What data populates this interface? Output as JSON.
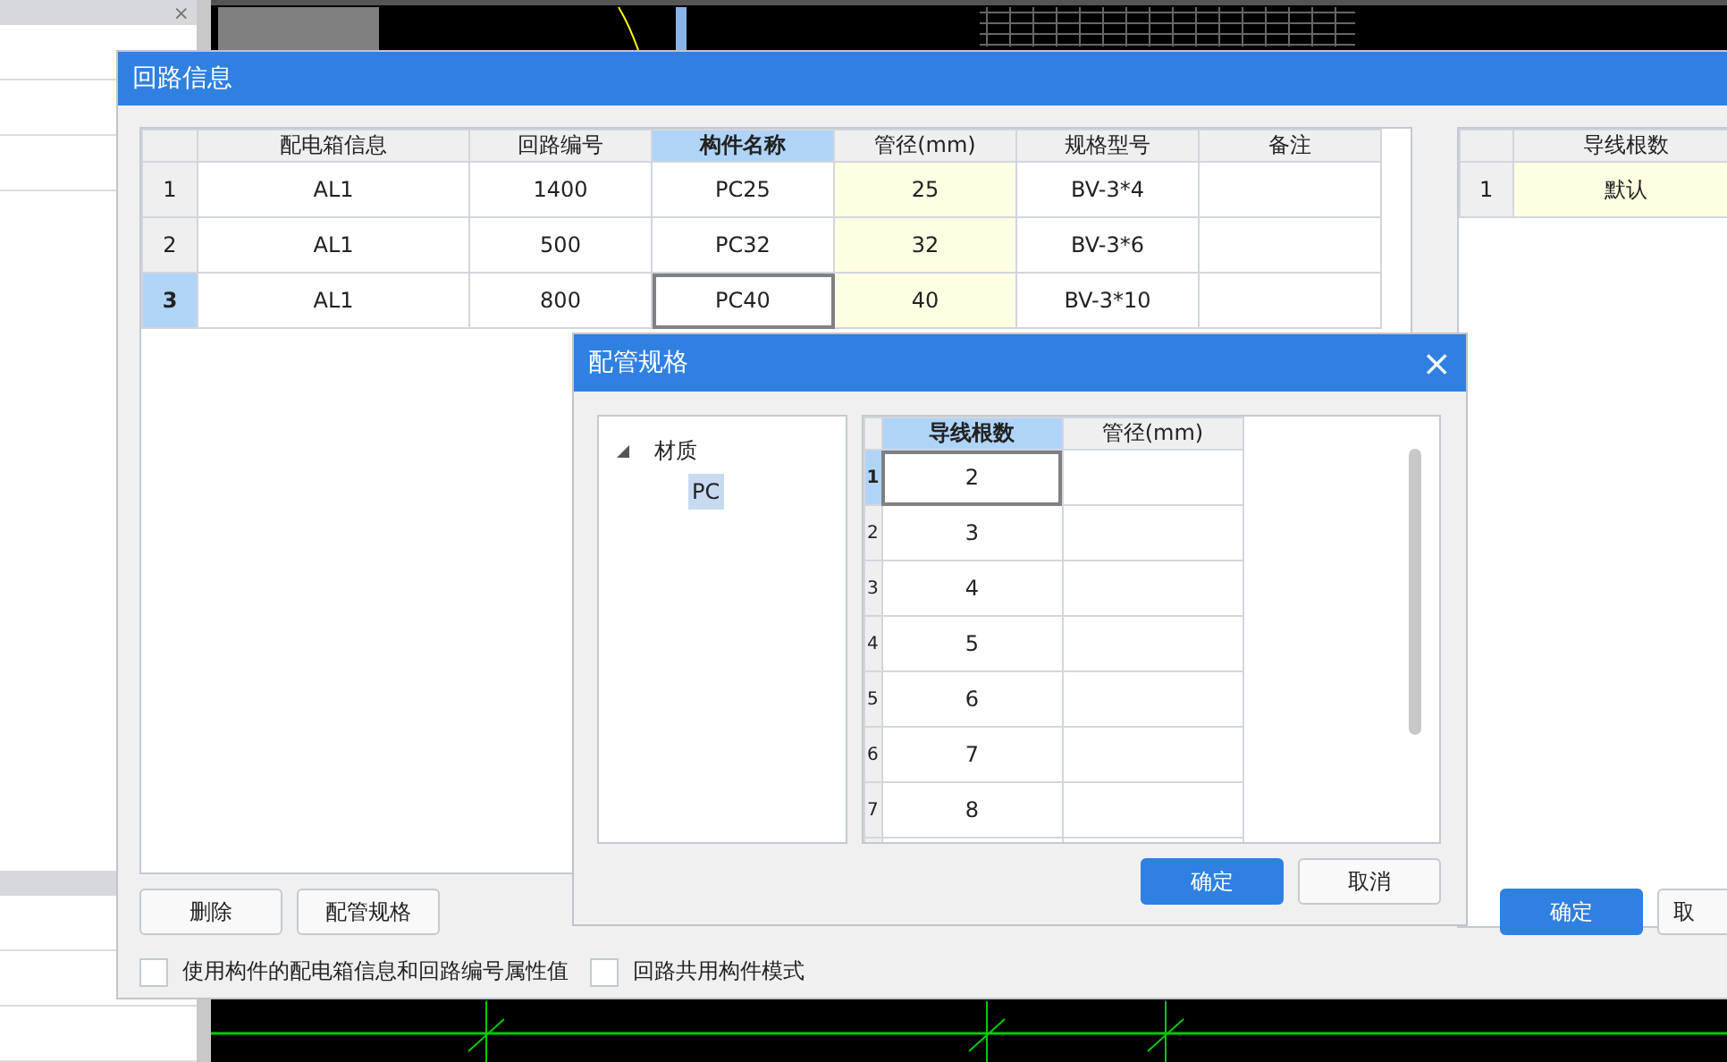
{
  "side_panel": {
    "close": "×"
  },
  "main_dialog": {
    "title": "回路信息",
    "table": {
      "columns": [
        {
          "label": "配电箱信息",
          "selected": false,
          "shaded": false
        },
        {
          "label": "回路编号",
          "selected": false,
          "shaded": false
        },
        {
          "label": "构件名称",
          "selected": true,
          "shaded": false
        },
        {
          "label": "管径(mm)",
          "selected": false,
          "shaded": true
        },
        {
          "label": "规格型号",
          "selected": false,
          "shaded": false
        },
        {
          "label": "备注",
          "selected": false,
          "shaded": false
        }
      ],
      "rows": [
        {
          "number": "1",
          "selected": false,
          "cells": [
            {
              "text": "AL1",
              "focused": false
            },
            {
              "text": "1400",
              "focused": false
            },
            {
              "text": "PC25",
              "focused": false
            },
            {
              "text": "25",
              "focused": false
            },
            {
              "text": "BV-3*4",
              "focused": false
            }
          ]
        },
        {
          "number": "2",
          "selected": false,
          "cells": [
            {
              "text": "AL1",
              "focused": false
            },
            {
              "text": "500",
              "focused": false
            },
            {
              "text": "PC32",
              "focused": false
            },
            {
              "text": "32",
              "focused": false
            },
            {
              "text": "BV-3*6",
              "focused": false
            }
          ]
        },
        {
          "number": "3",
          "selected": true,
          "cells": [
            {
              "text": "AL1",
              "focused": false
            },
            {
              "text": "800",
              "focused": false
            },
            {
              "text": "PC40",
              "focused": true
            },
            {
              "text": "40",
              "focused": false
            },
            {
              "text": "BV-3*10",
              "focused": false
            }
          ]
        }
      ]
    },
    "right_table": {
      "column": "导线根数",
      "rows": [
        {
          "number": "1",
          "value": "默认"
        }
      ]
    },
    "buttons": [
      {
        "label": "删除"
      },
      {
        "label": "配管规格"
      }
    ],
    "right_buttons": [
      {
        "label": "确定",
        "primary": true
      },
      {
        "label": "取",
        "primary": false
      }
    ],
    "checkboxes": [
      {
        "label": "使用构件的配电箱信息和回路编号属性值",
        "checked": false
      },
      {
        "label": "回路共用构件模式",
        "checked": false
      }
    ]
  },
  "spec_dialog": {
    "title": "配管规格",
    "close": "×",
    "tree": [
      {
        "label": "材质",
        "expanded": true,
        "children": [
          {
            "label": "PC",
            "selected": true
          }
        ]
      }
    ],
    "grid": {
      "columns": [
        "导线根数",
        "管径(mm)"
      ],
      "rows": [
        {
          "number": "1",
          "value": "2",
          "selected": true
        },
        {
          "number": "2",
          "value": "3",
          "selected": false
        },
        {
          "number": "3",
          "value": "4",
          "selected": false
        },
        {
          "number": "4",
          "value": "5",
          "selected": false
        },
        {
          "number": "5",
          "value": "6",
          "selected": false
        },
        {
          "number": "6",
          "value": "7",
          "selected": false
        },
        {
          "number": "7",
          "value": "8",
          "selected": false
        }
      ]
    },
    "buttons": [
      {
        "label": "确定",
        "primary": true
      },
      {
        "label": "取消",
        "primary": false
      }
    ]
  }
}
